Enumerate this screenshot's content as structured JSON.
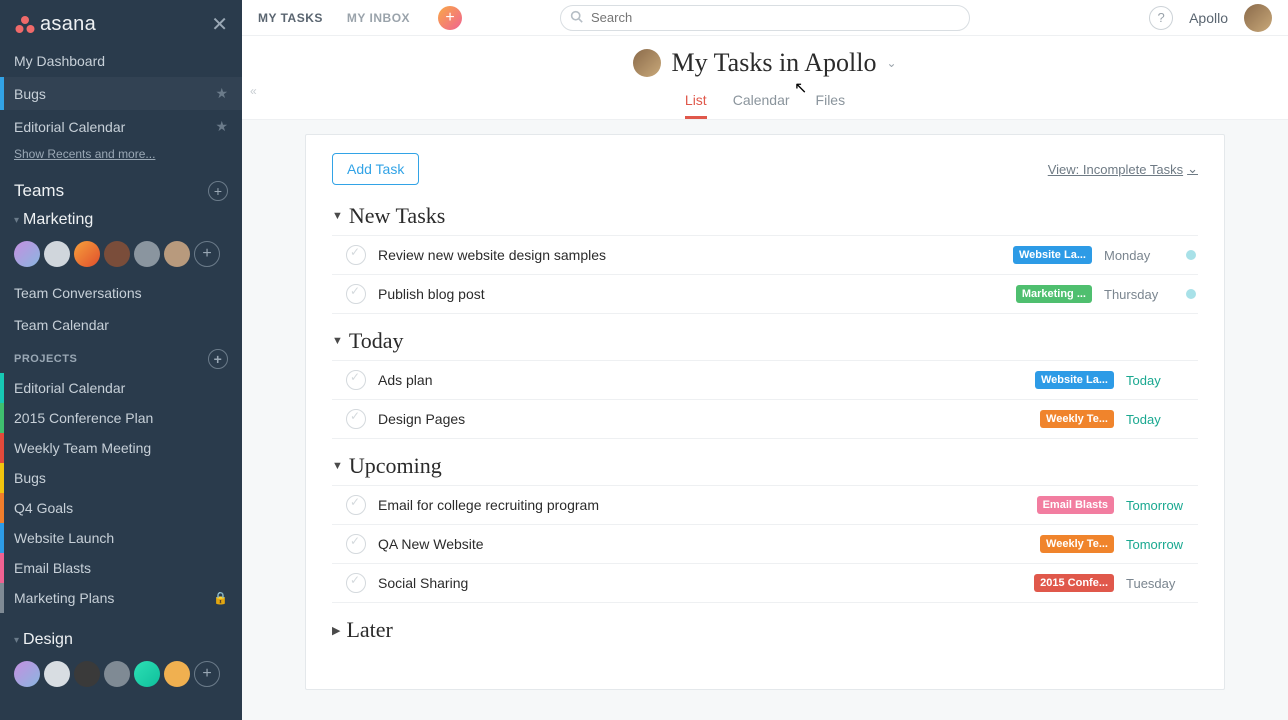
{
  "brand": "asana",
  "topnav": {
    "my_tasks": "MY TASKS",
    "my_inbox": "MY INBOX",
    "search_placeholder": "Search",
    "help": "?",
    "user": "Apollo"
  },
  "sidebar": {
    "dashboard": "My Dashboard",
    "fav1": "Bugs",
    "fav2": "Editorial Calendar",
    "recents": "Show Recents and more...",
    "teams_header": "Teams",
    "team_marketing": "Marketing",
    "team_conversations": "Team Conversations",
    "team_calendar": "Team Calendar",
    "projects_header": "PROJECTS",
    "projects": [
      {
        "label": "Editorial Calendar",
        "color": "pc-teal"
      },
      {
        "label": "2015 Conference Plan",
        "color": "pc-green"
      },
      {
        "label": "Weekly Team Meeting",
        "color": "pc-red"
      },
      {
        "label": "Bugs",
        "color": "pc-yellow"
      },
      {
        "label": "Q4 Goals",
        "color": "pc-orange"
      },
      {
        "label": "Website Launch",
        "color": "pc-blue"
      },
      {
        "label": "Email Blasts",
        "color": "pc-pink"
      },
      {
        "label": "Marketing Plans",
        "color": "pc-gray",
        "locked": true
      }
    ],
    "team_design": "Design"
  },
  "header": {
    "title": "My Tasks in Apollo",
    "tabs": {
      "list": "List",
      "calendar": "Calendar",
      "files": "Files"
    }
  },
  "card": {
    "add_task": "Add Task",
    "view_filter": "View: Incomplete Tasks",
    "sections": {
      "new": "New Tasks",
      "today": "Today",
      "upcoming": "Upcoming",
      "later": "Later"
    },
    "tasks_new": [
      {
        "title": "Review new website design samples",
        "tag": "Website La...",
        "tag_color": "blue",
        "due": "Monday",
        "due_color": "gray",
        "dot": true
      },
      {
        "title": "Publish blog post",
        "tag": "Marketing ...",
        "tag_color": "green",
        "due": "Thursday",
        "due_color": "gray",
        "dot": true
      }
    ],
    "tasks_today": [
      {
        "title": "Ads plan",
        "tag": "Website La...",
        "tag_color": "blue",
        "due": "Today",
        "due_color": "teal"
      },
      {
        "title": "Design Pages",
        "tag": "Weekly Te...",
        "tag_color": "orange",
        "due": "Today",
        "due_color": "teal"
      }
    ],
    "tasks_upcoming": [
      {
        "title": "Email for college recruiting program",
        "tag": "Email Blasts",
        "tag_color": "pink",
        "due": "Tomorrow",
        "due_color": "teal"
      },
      {
        "title": "QA New Website",
        "tag": "Weekly Te...",
        "tag_color": "orange",
        "due": "Tomorrow",
        "due_color": "teal"
      },
      {
        "title": "Social Sharing",
        "tag": "2015 Confe...",
        "tag_color": "red",
        "due": "Tuesday",
        "due_color": "gray"
      }
    ]
  }
}
